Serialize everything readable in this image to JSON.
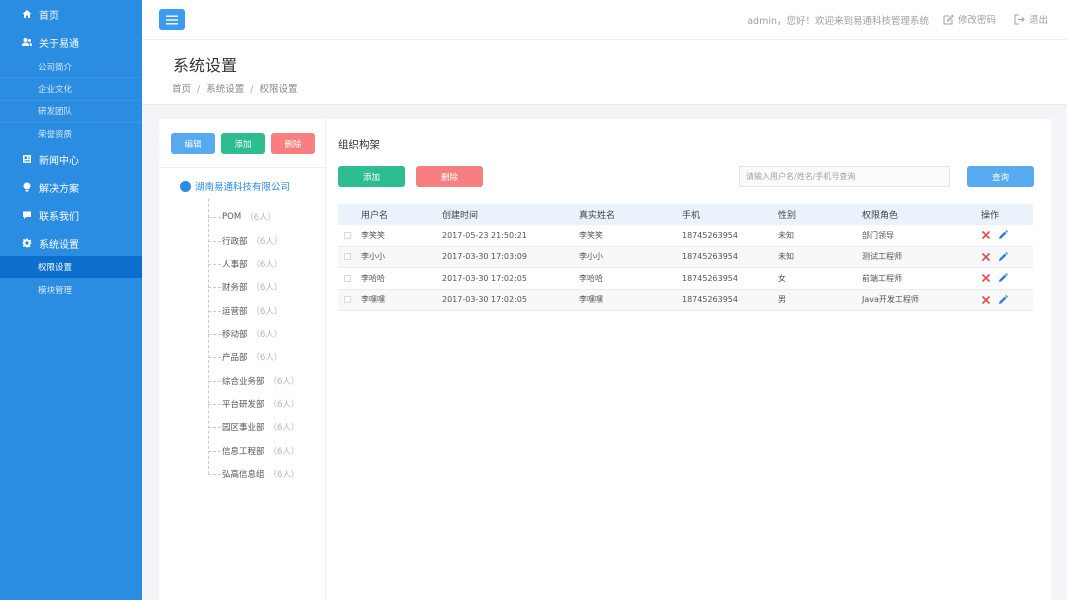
{
  "sidebar": {
    "items": [
      {
        "label": "首页",
        "icon": "home-icon"
      },
      {
        "label": "关于易通",
        "icon": "users-icon",
        "children": [
          "公司简介",
          "企业文化",
          "研发团队",
          "荣誉资质"
        ]
      },
      {
        "label": "新闻中心",
        "icon": "newspaper-icon"
      },
      {
        "label": "解决方案",
        "icon": "lightbulb-icon"
      },
      {
        "label": "联系我们",
        "icon": "chat-icon"
      },
      {
        "label": "系统设置",
        "icon": "gear-icon",
        "children": [
          "权限设置",
          "模块管理"
        ],
        "active_child": "权限设置"
      }
    ]
  },
  "header": {
    "welcome": "admin，您好！欢迎来到易通科技管理系统",
    "change_password": "修改密码",
    "logout": "退出"
  },
  "page": {
    "title": "系统设置",
    "breadcrumb": [
      "首页",
      "系统设置",
      "权限设置"
    ]
  },
  "tree": {
    "buttons": {
      "edit": "编辑",
      "add": "添加",
      "delete": "删除"
    },
    "root": "湖南易通科技有限公司",
    "nodes": [
      {
        "name": "POM",
        "count": "（6人）"
      },
      {
        "name": "行政部",
        "count": "（6人）"
      },
      {
        "name": "人事部",
        "count": "（6人）"
      },
      {
        "name": "财务部",
        "count": "（6人）"
      },
      {
        "name": "运营部",
        "count": "（6人）"
      },
      {
        "name": "移动部",
        "count": "（6人）"
      },
      {
        "name": "产品部",
        "count": "（6人）"
      },
      {
        "name": "综合业务部",
        "count": "（6人）"
      },
      {
        "name": "平台研发部",
        "count": "（6人）"
      },
      {
        "name": "园区事业部",
        "count": "（6人）"
      },
      {
        "name": "信息工程部",
        "count": "（6人）"
      },
      {
        "name": "弘高信息组",
        "count": "（6人）"
      }
    ]
  },
  "main": {
    "section_title": "组织构架",
    "add": "添加",
    "delete": "删除",
    "search_placeholder": "请输入用户名/姓名/手机号查询",
    "search_button": "查询",
    "table": {
      "columns": [
        "用户名",
        "创建时间",
        "真实姓名",
        "手机",
        "性别",
        "权限角色",
        "操作"
      ],
      "rows": [
        {
          "username": "李笑笑",
          "created": "2017-05-23 21:50:21",
          "realname": "李笑笑",
          "phone": "18745263954",
          "gender": "未知",
          "role": "部门领导"
        },
        {
          "username": "李小小",
          "created": "2017-03-30 17:03:09",
          "realname": "李小小",
          "phone": "18745263954",
          "gender": "未知",
          "role": "测试工程师"
        },
        {
          "username": "李哈哈",
          "created": "2017-03-30 17:02:05",
          "realname": "李哈哈",
          "phone": "18745263954",
          "gender": "女",
          "role": "前端工程师"
        },
        {
          "username": "李嘿嘿",
          "created": "2017-03-30 17:02:05",
          "realname": "李嘿嘿",
          "phone": "18745263954",
          "gender": "男",
          "role": "Java开发工程师"
        }
      ]
    }
  },
  "colors": {
    "sidebar": "#2a8de2",
    "sidebar_active": "#0b6fcb",
    "primary": "#57aaf0",
    "success": "#2ebd8f",
    "danger": "#f77f7f",
    "delete_icon": "#e84b4b",
    "edit_icon": "#2a7fd4"
  }
}
